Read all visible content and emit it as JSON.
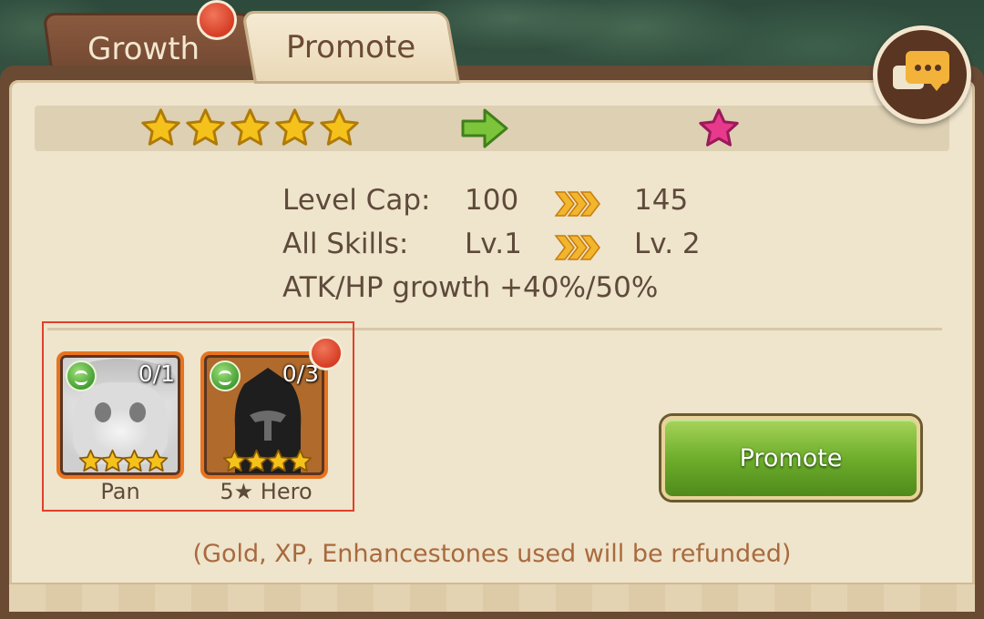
{
  "tabs": [
    {
      "label": "Growth",
      "active": false,
      "has_notification": true
    },
    {
      "label": "Promote",
      "active": true
    }
  ],
  "chat": {
    "icon": "chat-bubbles-icon"
  },
  "star_progress": {
    "current_stars": 5,
    "next_stars": 1,
    "current_color": "#f5c21b",
    "next_color": "#e83a8c"
  },
  "stats": {
    "level_cap": {
      "label": "Level Cap:",
      "from": "100",
      "to": "145"
    },
    "all_skills": {
      "label": "All Skills:",
      "from": "Lv.1",
      "to": "Lv. 2"
    },
    "growth": "ATK/HP growth +40%/50%"
  },
  "materials": [
    {
      "name": "Pan",
      "count": "0/1",
      "element": "wind-icon",
      "stars": 4,
      "has_notification": false
    },
    {
      "name": "5★ Hero",
      "count": "0/3",
      "element": "wind-icon",
      "stars": 4,
      "has_notification": true
    }
  ],
  "promote_button": {
    "label": "Promote"
  },
  "refund_note": "(Gold, XP, Enhancestones used will be refunded)"
}
